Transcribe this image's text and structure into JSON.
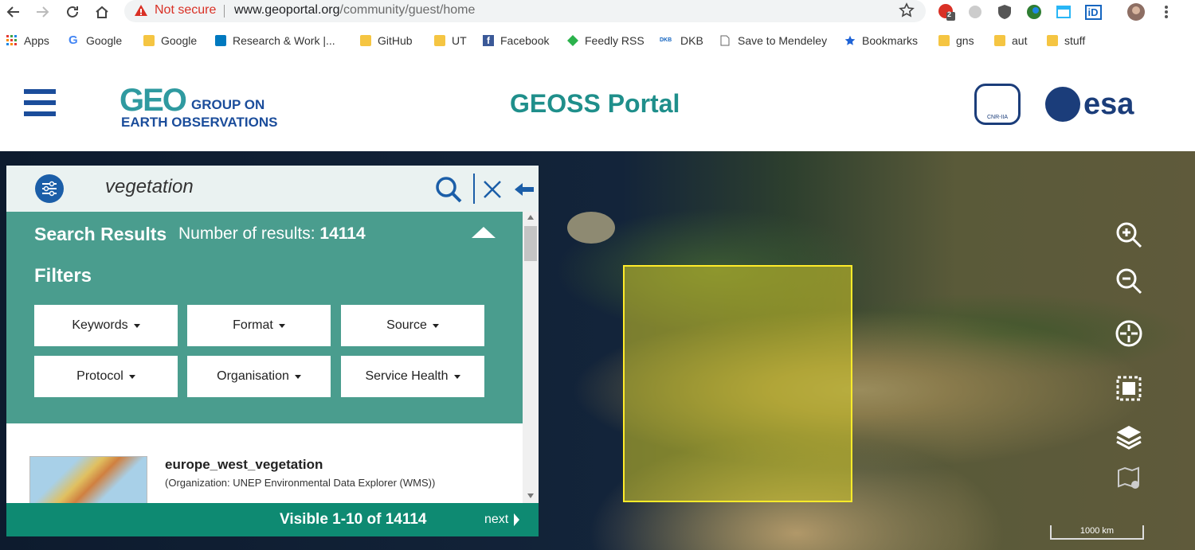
{
  "browser": {
    "security_label": "Not secure",
    "url_domain": "www.geoportal.org",
    "url_path": "/community/guest/home",
    "extension_badge": "2",
    "extension_id_label": "iD"
  },
  "bookmarks": [
    {
      "label": "Apps",
      "icon": "apps-grid-icon"
    },
    {
      "label": "Google",
      "icon": "google-icon"
    },
    {
      "label": "Google",
      "icon": "folder-icon"
    },
    {
      "label": "Research & Work |...",
      "icon": "trello-icon"
    },
    {
      "label": "GitHub",
      "icon": "folder-icon"
    },
    {
      "label": "UT",
      "icon": "folder-icon"
    },
    {
      "label": "Facebook",
      "icon": "facebook-icon"
    },
    {
      "label": "Feedly RSS",
      "icon": "feedly-icon"
    },
    {
      "label": "DKB",
      "icon": "dkb-icon"
    },
    {
      "label": "Save to Mendeley",
      "icon": "page-icon"
    },
    {
      "label": "Bookmarks",
      "icon": "star-icon"
    },
    {
      "label": "gns",
      "icon": "folder-icon"
    },
    {
      "label": "aut",
      "icon": "folder-icon"
    },
    {
      "label": "stuff",
      "icon": "folder-icon"
    }
  ],
  "header": {
    "geo_text_line1": "GROUP ON",
    "geo_text_line2": "EARTH OBSERVATIONS",
    "portal_title": "GEOSS Portal",
    "cnr_label": "CNR-IIA",
    "esa_label": "esa"
  },
  "search": {
    "query": "vegetation"
  },
  "results": {
    "title": "Search Results",
    "count_label": "Number of results:",
    "count": "14114",
    "filters_title": "Filters",
    "filters": [
      "Keywords",
      "Format",
      "Source",
      "Protocol",
      "Organisation",
      "Service Health"
    ],
    "item": {
      "title": "europe_west_vegetation",
      "org": "(Organization: UNEP Environmental Data Explorer (WMS))"
    },
    "pager_text": "Visible 1-10 of 14114",
    "next_label": "next"
  },
  "map": {
    "scale_label": "1000 km",
    "bbox_color": "#ffeb2a"
  },
  "colors": {
    "panel_teal": "#4a9d8e",
    "pager_green": "#0e8a72",
    "brand_blue": "#1b5ea8"
  }
}
